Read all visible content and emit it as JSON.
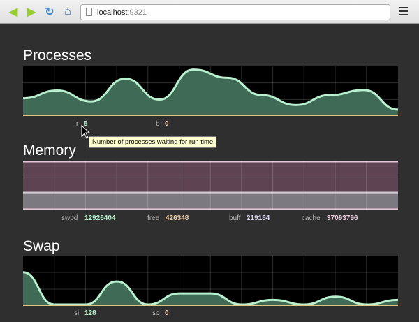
{
  "browser": {
    "url_host": "localhost",
    "url_port": ":9321",
    "icons": [
      "back-arrow-icon",
      "forward-arrow-icon",
      "reload-icon",
      "home-icon",
      "page-icon",
      "menu-icon"
    ]
  },
  "processes": {
    "title": "Processes",
    "series": [
      3.6,
      5.3,
      2.9,
      7.9,
      3.3,
      9.9,
      8.1,
      4.3,
      2.1,
      4.3,
      5.4,
      1.1
    ],
    "labels": {
      "r": "r",
      "r_value": "5",
      "b": "b",
      "b_value": "0"
    },
    "tooltip": "Number of processes waiting for run time",
    "colors": {
      "line": "#b8f0d0",
      "fill": "#3f6a55"
    }
  },
  "memory": {
    "title": "Memory",
    "labels": {
      "swpd": "swpd",
      "swpd_value": "12926404",
      "free": "free",
      "free_value": "426348",
      "buff": "buff",
      "buff_value": "219184",
      "cache": "cache",
      "cache_value": "37093796"
    },
    "colors": {
      "top": "#5e4452",
      "bottom": "#7d7980",
      "line": "#e8c8d8"
    }
  },
  "swap": {
    "title": "Swap",
    "series": [
      7,
      0,
      0,
      5,
      0,
      2.4,
      2.4,
      0,
      1,
      0,
      1.7,
      0,
      1
    ],
    "labels": {
      "si": "si",
      "si_value": "128",
      "so": "so",
      "so_value": "0"
    }
  }
}
